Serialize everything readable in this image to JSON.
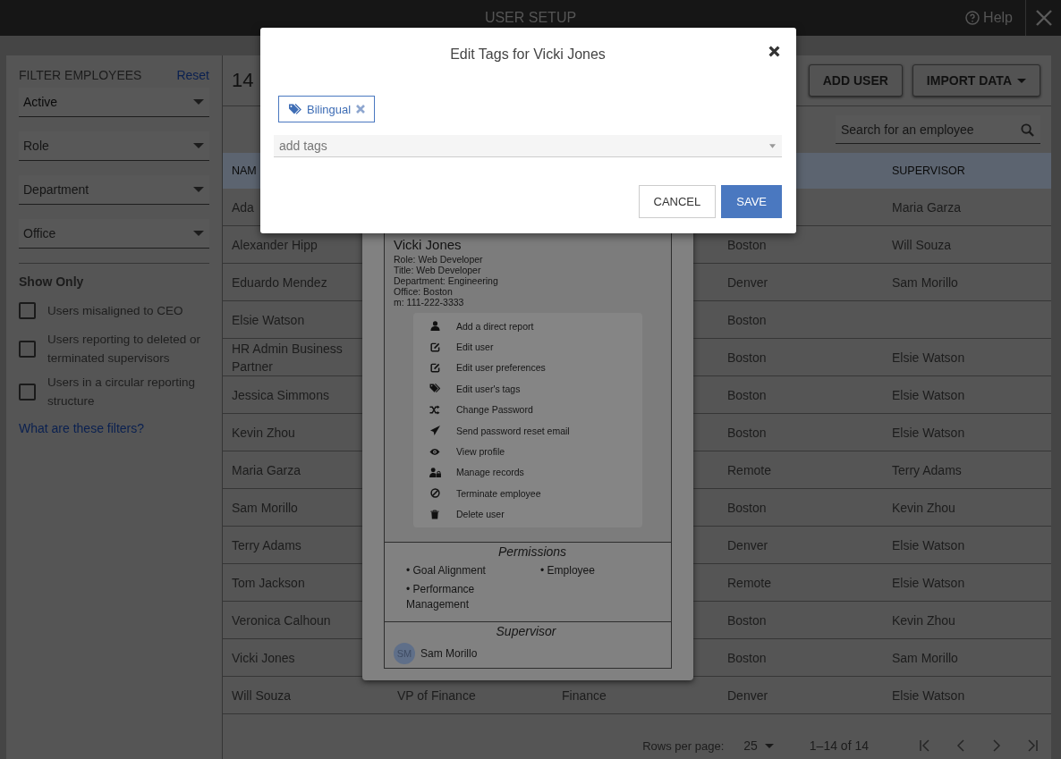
{
  "window": {
    "title": "USER SETUP",
    "help": "Help"
  },
  "filters": {
    "title": "FILTER EMPLOYEES",
    "reset": "Reset",
    "selects": [
      {
        "value": "Active"
      },
      {
        "placeholder": "Role"
      },
      {
        "placeholder": "Department"
      },
      {
        "placeholder": "Office"
      }
    ],
    "show_only": {
      "title": "Show Only",
      "options": [
        {
          "label": "Users misaligned to CEO",
          "checked": false
        },
        {
          "label": "Users reporting to deleted or terminated supervisors",
          "checked": false
        },
        {
          "label": "Users in a circular reporting structure",
          "checked": false
        }
      ]
    },
    "help_link": "What are these filters?"
  },
  "main": {
    "count": "14",
    "buttons": [
      {
        "label": "ADD USER",
        "kind": "plain"
      },
      {
        "label": "IMPORT DATA",
        "kind": "dropdown"
      }
    ],
    "search": {
      "placeholder": "Search for an employee"
    }
  },
  "table": {
    "header": {
      "name": "NAM",
      "supervisor": "SUPERVISOR"
    },
    "rows": [
      {
        "name": "Ada",
        "supervisor": "Maria Garza"
      },
      {
        "name": "Alexander Hipp",
        "office": "Boston",
        "supervisor": "Will Souza"
      },
      {
        "name": "Eduardo Mendez",
        "office": "Denver",
        "supervisor": "Sam Morillo"
      },
      {
        "name": "Elsie Watson",
        "office": "Boston"
      },
      {
        "name": "HR Admin Business Partner",
        "office": "Boston",
        "supervisor": "Elsie Watson"
      },
      {
        "name": "Jessica Simmons",
        "office": "Boston",
        "supervisor": "Elsie Watson"
      },
      {
        "name": "Kevin Zhou",
        "office": "Boston",
        "supervisor": "Elsie Watson"
      },
      {
        "name": "Maria Garza",
        "office": "Remote",
        "supervisor": "Terry Adams"
      },
      {
        "name": "Sam Morillo",
        "office": "Boston",
        "supervisor": "Kevin Zhou"
      },
      {
        "name": "Terry Adams",
        "office": "Denver",
        "supervisor": "Elsie Watson"
      },
      {
        "name": "Tom Jackson",
        "office": "Remote",
        "supervisor": "Elsie Watson"
      },
      {
        "name": "Veronica Calhoun",
        "office": "Boston",
        "supervisor": "Kevin Zhou"
      },
      {
        "name": "Vicki Jones",
        "office": "Boston",
        "supervisor": "Sam Morillo"
      },
      {
        "name": "Will Souza",
        "title": "VP of Finance",
        "department": "Finance",
        "office": "Denver",
        "supervisor": "Elsie Watson"
      }
    ]
  },
  "pagination": {
    "rows_per_page_label": "Rows per page:",
    "rows_per_page": "25",
    "range": "1–14 of 14"
  },
  "profile_card": {
    "name": "Vicki Jones",
    "details": [
      "Role: Web Developer",
      "Title: Web Developer",
      "Department: Engineering",
      "Office: Boston",
      "m: 111-222-3333"
    ],
    "actions": [
      "Add a direct report",
      "Edit user",
      "Edit user preferences",
      "Edit user's tags",
      "Change Password",
      "Send password reset email",
      "View profile",
      "Manage records",
      "Terminate employee",
      "Delete user"
    ],
    "permissions": {
      "title": "Permissions",
      "items": [
        "• Goal Alignment",
        "• Employee",
        "• Performance Management"
      ]
    },
    "supervisor": {
      "title": "Supervisor",
      "initials": "SM",
      "name": "Sam Morillo"
    }
  },
  "modal": {
    "title": "Edit Tags for Vicki Jones",
    "tags": [
      "Bilingual"
    ],
    "input": {
      "placeholder": "add tags"
    },
    "buttons": [
      {
        "label": "CANCEL",
        "kind": "secondary"
      },
      {
        "label": "SAVE",
        "kind": "primary"
      }
    ]
  }
}
